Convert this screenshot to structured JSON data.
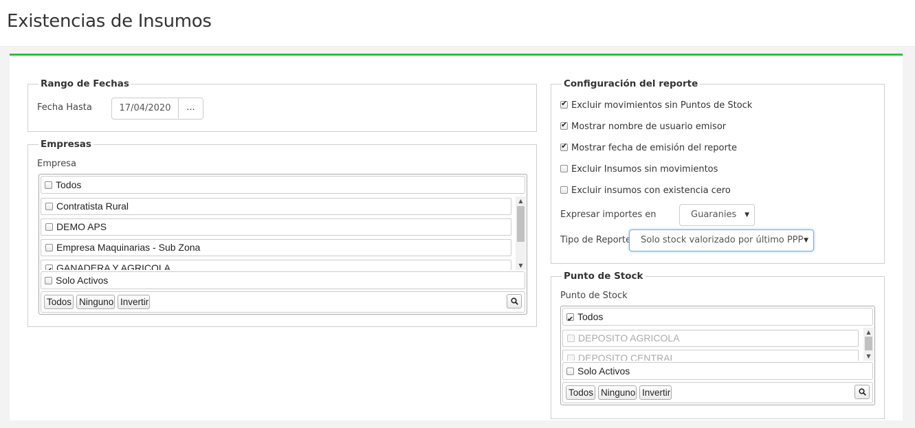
{
  "page": {
    "title": "Existencias de Insumos",
    "accent_color": "#1ec832"
  },
  "rango_fechas": {
    "legend": "Rango de Fechas",
    "fecha_hasta_label": "Fecha Hasta",
    "fecha_hasta_value": "17/04/2020",
    "picker_label": "..."
  },
  "empresas": {
    "legend": "Empresas",
    "field_label": "Empresa",
    "todos_label": "Todos",
    "todos_checked": false,
    "items": [
      {
        "label": "Contratista Rural",
        "checked": false
      },
      {
        "label": "DEMO APS",
        "checked": false
      },
      {
        "label": "Empresa Maquinarias - Sub Zona",
        "checked": false
      },
      {
        "label": "GANADERA Y AGRICOLA",
        "checked": true
      }
    ],
    "solo_activos_label": "Solo Activos",
    "solo_activos_checked": false,
    "footer_buttons": [
      "Todos",
      "Ninguno",
      "Invertir"
    ]
  },
  "configuracion": {
    "legend": "Configuración del reporte",
    "options": [
      {
        "label": "Excluir movimientos sin Puntos de Stock",
        "checked": true
      },
      {
        "label": "Mostrar nombre de usuario emisor",
        "checked": true
      },
      {
        "label": "Mostrar fecha de emisión del reporte",
        "checked": true
      },
      {
        "label": "Excluir Insumos sin movimientos",
        "checked": false
      },
      {
        "label": "Excluir insumos con existencia cero",
        "checked": false
      }
    ],
    "importes_label": "Expresar importes en",
    "importes_value": "Guaranies",
    "tipo_label": "Tipo de Reporte",
    "tipo_value": "Solo stock valorizado por último PPP"
  },
  "punto_stock": {
    "legend": "Punto de Stock",
    "field_label": "Punto de Stock",
    "todos_label": "Todos",
    "todos_checked": true,
    "items": [
      {
        "label": "DEPOSITO AGRICOLA",
        "checked": false
      },
      {
        "label": "DEPOSITO CENTRAL",
        "checked": false
      }
    ],
    "solo_activos_label": "Solo Activos",
    "solo_activos_checked": false,
    "footer_buttons": [
      "Todos",
      "Ninguno",
      "Invertir"
    ]
  }
}
